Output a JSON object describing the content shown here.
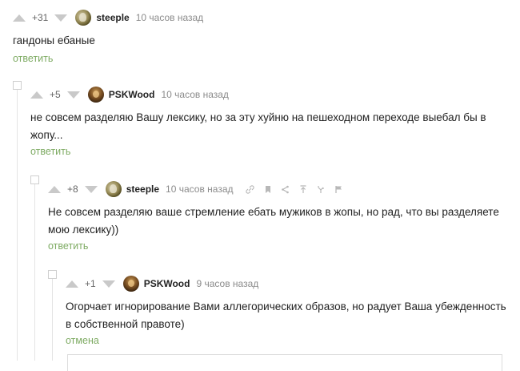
{
  "comments": [
    {
      "rating": "+31",
      "author": "steeple",
      "time": "10 часов назад",
      "text": "гандоны ебаные",
      "action": "ответить"
    },
    {
      "rating": "+5",
      "author": "PSKWood",
      "time": "10 часов назад",
      "text_line1": "не совсем разделяю Вашу лексику, но за эту хуйню на пешеходном переходе выебал бы в",
      "text_line2": "жопу...",
      "action": "ответить"
    },
    {
      "rating": "+8",
      "author": "steeple",
      "time": "10 часов назад",
      "text_line1": "Не совсем разделяю ваше стремление ебать мужиков в жопы, но рад, что вы разделяете",
      "text_line2": "мою лексику))",
      "action": "ответить",
      "tools": [
        "link-icon",
        "bookmark-icon",
        "share-icon",
        "up-arrow-icon",
        "branch-icon",
        "flag-icon"
      ]
    },
    {
      "rating": "+1",
      "author": "PSKWood",
      "time": "9 часов назад",
      "text_line1": "Огорчает игнорирование Вами аллегорических образов, но радует Ваша убежденность",
      "text_line2": "в собственной правоте)",
      "action": "отмена"
    }
  ],
  "colors": {
    "accent": "#7eab63",
    "vote_arrow": "#c9c9c9",
    "time": "#8b8b8b"
  }
}
